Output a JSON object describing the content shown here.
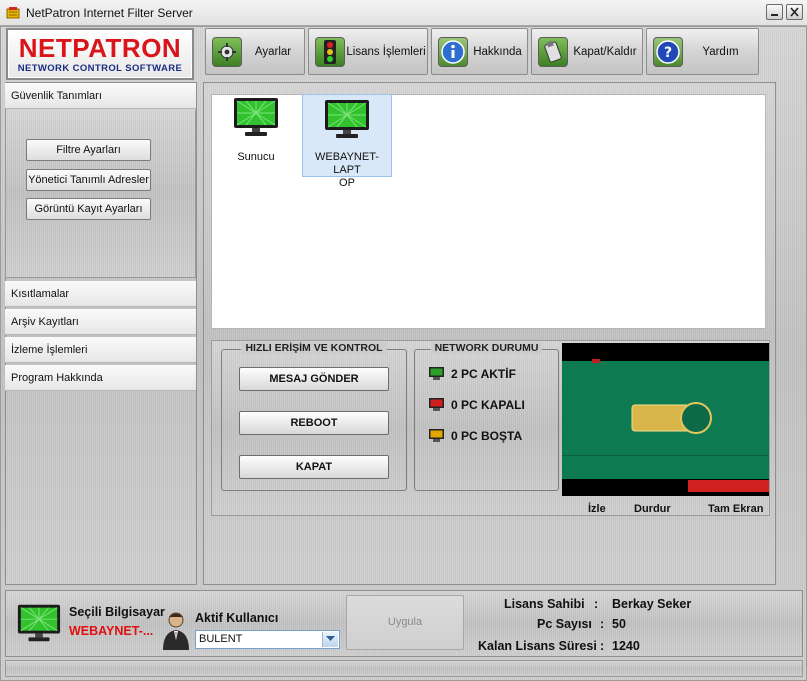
{
  "window": {
    "title": "NetPatron Internet Filter Server",
    "controls": [
      "minimize",
      "close"
    ]
  },
  "logo": {
    "line1": "NETPATRON",
    "line2": "NETWORK CONTROL SOFTWARE"
  },
  "toolbar": [
    {
      "label": "Ayarlar",
      "icon": "settings-icon"
    },
    {
      "label": "Lisans İşlemleri",
      "icon": "traffic-light-icon"
    },
    {
      "label": "Hakkında",
      "icon": "info-icon"
    },
    {
      "label": "Kapat/Kaldır",
      "icon": "usb-icon"
    },
    {
      "label": "Yardım",
      "icon": "help-icon"
    }
  ],
  "sidebar": {
    "sections": [
      {
        "label": "Güvenlik Tanımları"
      },
      {
        "label": "Kısıtlamalar"
      },
      {
        "label": "Arşiv Kayıtları"
      },
      {
        "label": "İzleme İşlemleri"
      },
      {
        "label": "Program Hakkında"
      }
    ],
    "buttons": [
      {
        "label": "Filtre Ayarları"
      },
      {
        "label": "Yönetici Tanımlı Adresler"
      },
      {
        "label": "Görüntü Kayıt Ayarları"
      }
    ]
  },
  "computers": [
    {
      "name": "Sunucu",
      "selected": false
    },
    {
      "name_line1": "WEBAYNET-LAPT",
      "name_line2": "OP",
      "selected": true
    }
  ],
  "quick_access": {
    "title": "HIZLI ERİŞİM VE KONTROL",
    "buttons": [
      "MESAJ GÖNDER",
      "REBOOT",
      "KAPAT"
    ]
  },
  "network_status": {
    "title": "NETWORK DURUMU",
    "lines": [
      {
        "text": "2 PC AKTİF",
        "color": "#2aa02a"
      },
      {
        "text": "0 PC KAPALI",
        "color": "#d21e1e"
      },
      {
        "text": "0 PC BOŞTA",
        "color": "#e0a800"
      }
    ]
  },
  "video": {
    "links": [
      "İzle",
      "Durdur",
      "Tam Ekran"
    ],
    "bg_color": "#0e7a52"
  },
  "status": {
    "selected_pc_label": "Seçili Bilgisayar",
    "selected_pc_value": "WEBAYNET-...",
    "active_user_label": "Aktif Kullanıcı",
    "active_user_value": "BULENT",
    "apply_label": "Uygula",
    "license_owner_label": "Lisans Sahibi",
    "license_owner_value": "Berkay Seker",
    "pc_count_label": "Pc Sayısı",
    "pc_count_value": "50",
    "remaining_label": "Kalan Lisans Süresi",
    "remaining_value": "1240",
    "separator": ":"
  }
}
